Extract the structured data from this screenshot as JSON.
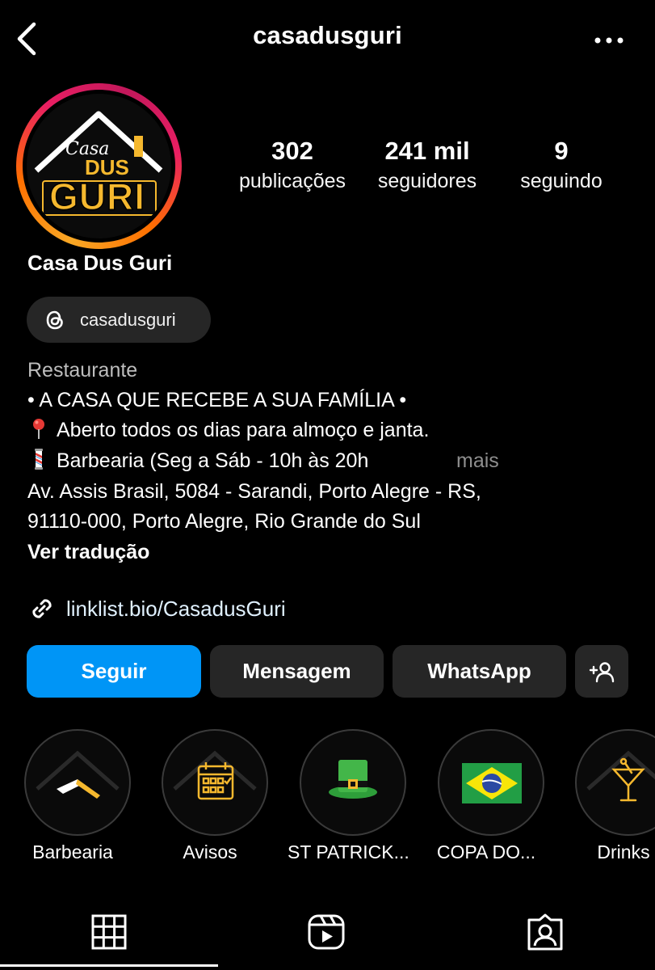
{
  "header": {
    "username": "casadusguri"
  },
  "profile": {
    "display_name": "Casa Dus Guri",
    "avatar_logo": {
      "line1": "Casa",
      "line2": "DUS",
      "line3": "GURI"
    },
    "stats": [
      {
        "value": "302",
        "label": "publicações"
      },
      {
        "value": "241 mil",
        "label": "seguidores"
      },
      {
        "value": "9",
        "label": "seguindo"
      }
    ],
    "threads_handle": "casadusguri",
    "bio": {
      "category": "Restaurante",
      "line1": "• A CASA QUE RECEBE A SUA FAMÍLIA •",
      "line2": "Aberto todos os dias para almoço e janta.",
      "line3": "Barbearia (Seg a Sáb - 10h às 20h",
      "more": "mais",
      "address_line1": "Av. Assis Brasil, 5084 - Sarandi, Porto Alegre - RS,",
      "address_line2": "91110-000, Porto Alegre, Rio Grande do Sul",
      "translate": "Ver tradução"
    },
    "link": "linklist.bio/CasadusGuri"
  },
  "buttons": {
    "follow": "Seguir",
    "message": "Mensagem",
    "whatsapp": "WhatsApp"
  },
  "highlights": [
    {
      "label": "Barbearia",
      "icon": "razor-icon"
    },
    {
      "label": "Avisos",
      "icon": "calendar-icon"
    },
    {
      "label": "ST PATRICK...",
      "icon": "leprechaun-hat-icon"
    },
    {
      "label": "COPA DO...",
      "icon": "brazil-flag-icon"
    },
    {
      "label": "Drinks",
      "icon": "cocktail-icon"
    }
  ],
  "tabs": [
    "grid-icon",
    "reels-icon",
    "tagged-icon"
  ],
  "colors": {
    "background": "#000000",
    "follow_button": "#0095f6",
    "secondary_button": "#262626",
    "logo_accent": "#f5b82e"
  }
}
